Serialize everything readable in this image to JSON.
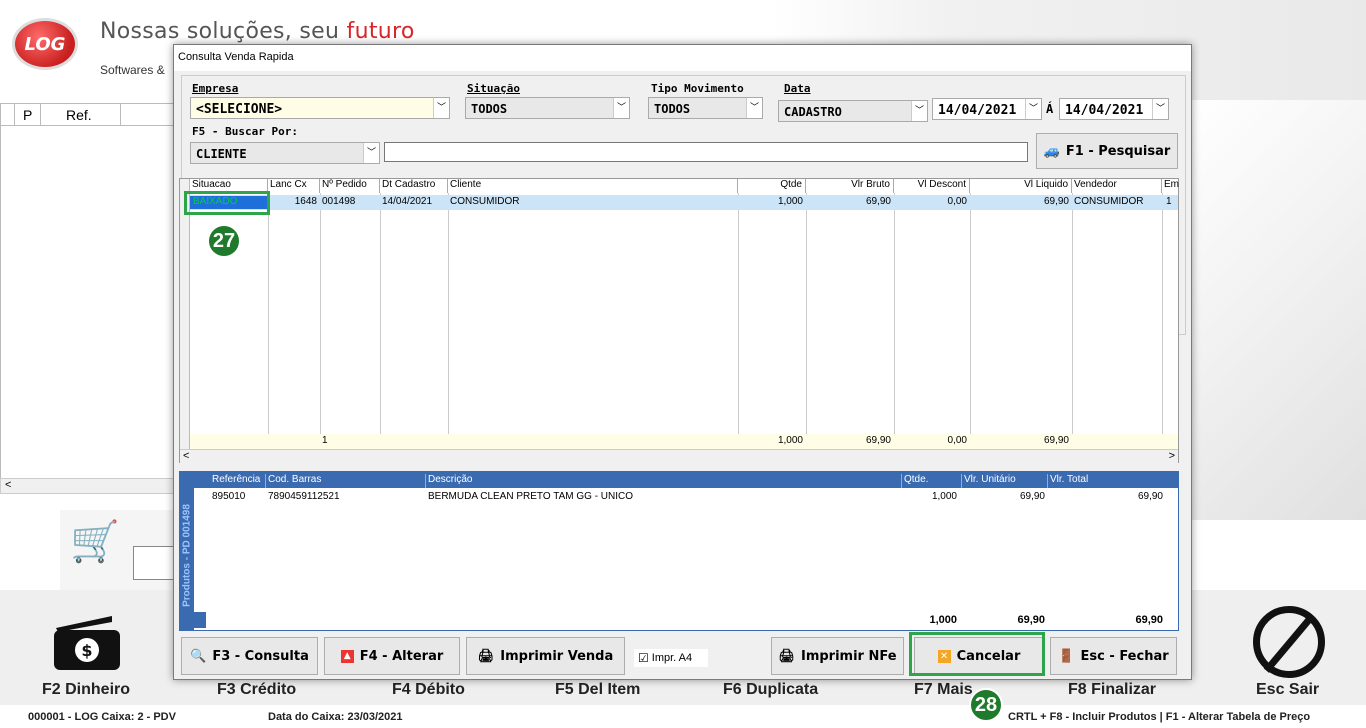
{
  "app": {
    "slogan_a": "Nossas soluções, seu ",
    "slogan_b": "futuro",
    "sub": "Softwares &",
    "logo": "LOG"
  },
  "leftgrid": {
    "col_p": "P",
    "col_ref": "Ref."
  },
  "fkeys": [
    "F2 Dinheiro",
    "F3 Crédito",
    "F4 Débito",
    "F5 Del Item",
    "F6 Duplicata",
    "F7 Mais",
    "F8 Finalizar",
    "Esc Sair"
  ],
  "status": {
    "left": "000001 - LOG   Caixa: 2 - PDV",
    "date": "Data do Caixa: 23/03/2021",
    "right": "CRTL + F8 - Incluir Produtos | F1 - Alterar Tabela de Preço"
  },
  "dialog": {
    "title": "Consulta Venda Rapida",
    "empresa_label": "Empresa",
    "empresa_value": "<SELECIONE>",
    "situacao_label": "Situação",
    "situacao_value": "TODOS",
    "tipo_label": "Tipo Movimento",
    "tipo_value": "TODOS",
    "data_label": "Data",
    "data_value": "CADASTRO",
    "date_from": "14/04/2021",
    "date_sep": "Á",
    "date_to": "14/04/2021",
    "buscar_label": "F5 - Buscar Por:",
    "buscar_value": "CLIENTE",
    "search_value": "",
    "pesquisar": "F1 - Pesquisar",
    "grid_headers": [
      "Situacao",
      "Lanc Cx",
      "Nº Pedido",
      "Dt Cadastro",
      "Cliente",
      "Qtde",
      "Vlr Bruto",
      "Vl Descont",
      "Vl Liquido",
      "Vendedor",
      "Em"
    ],
    "grid_row": [
      "BAIXADO",
      "1648",
      "001498",
      "14/04/2021",
      "CONSUMIDOR",
      "1,000",
      "69,90",
      "0,00",
      "69,90",
      "CONSUMIDOR",
      "1"
    ],
    "grid_totals": {
      "count": "1",
      "qtde": "1,000",
      "bruto": "69,90",
      "desc": "0,00",
      "liq": "69,90"
    },
    "items_headers": [
      "Referência",
      "Cod. Barras",
      "Descrição",
      "Qtde.",
      "Vlr. Unitário",
      "Vlr. Total"
    ],
    "items_row": [
      "895010",
      "7890459112521",
      "BERMUDA CLEAN PRETO TAM  GG - UNICO",
      "1,000",
      "69,90",
      "69,90"
    ],
    "items_totals": {
      "qtde": "1,000",
      "unit": "69,90",
      "total": "69,90"
    },
    "side_label": "Produtos - PD 001498",
    "btn_consulta": "F3 - Consulta",
    "btn_alterar": "F4 - Alterar",
    "btn_imprimir": "Imprimir Venda",
    "chk_a4": "Impr. A4",
    "btn_nfe": "Imprimir NFe",
    "btn_cancelar": "Cancelar",
    "btn_fechar": "Esc - Fechar"
  },
  "badges": {
    "b27": "27",
    "b28": "28"
  },
  "colors": {
    "accent": "#2ea54a",
    "badge": "#1f7a2c",
    "selected_row": "#cce4f7"
  }
}
